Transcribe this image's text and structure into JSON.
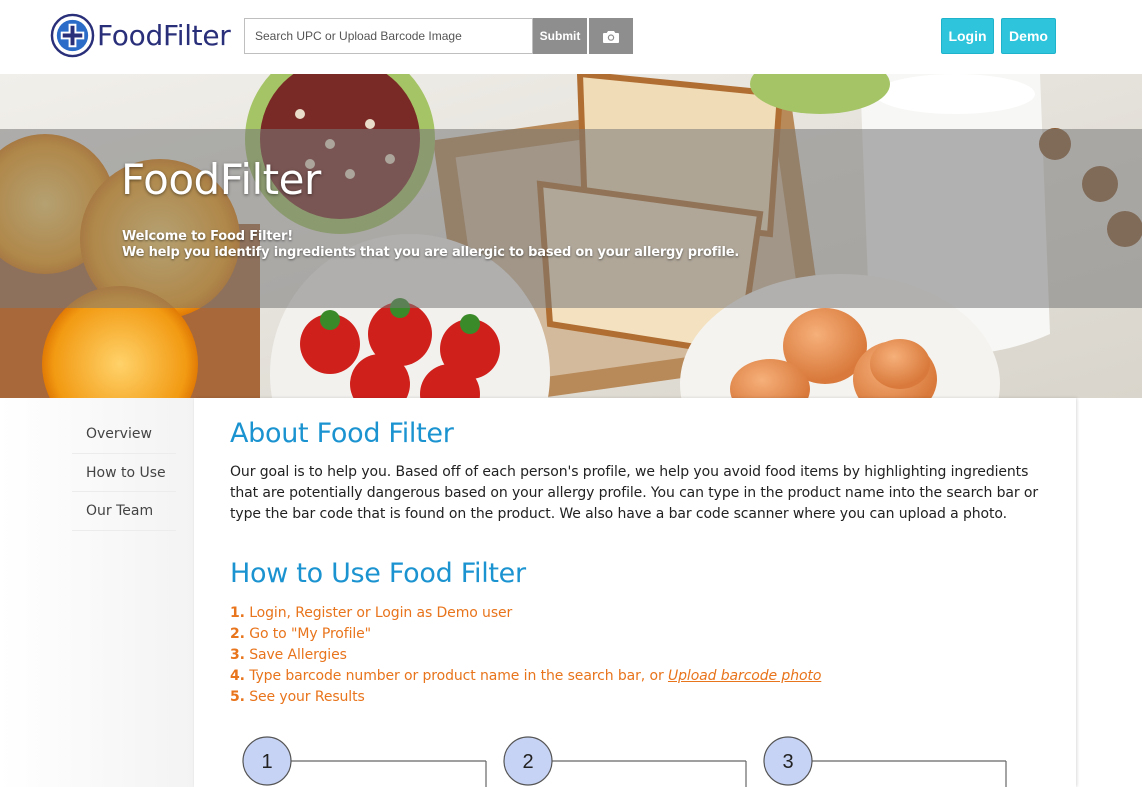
{
  "header": {
    "logo_text": "FoodFilter",
    "search_placeholder": "Search UPC or Upload Barcode Image",
    "submit_label": "Submit",
    "camera_icon": "camera-icon",
    "login_label": "Login",
    "demo_label": "Demo",
    "accent_color": "#2dc4dc"
  },
  "hero": {
    "title": "FoodFilter",
    "line1": "Welcome to Food Filter!",
    "line2": "We help you identify ingredients that you are allergic to based on your allergy profile."
  },
  "sidebar": {
    "items": [
      {
        "label": "Overview"
      },
      {
        "label": "How to Use"
      },
      {
        "label": "Our Team"
      }
    ]
  },
  "main": {
    "about_title": "About Food Filter",
    "about_text": "Our goal is to help you. Based off of each person's profile, we help you avoid food items by highlighting ingredients that are potentially dangerous based on your allergy profile. You can type in the product name into the search bar or type the bar code that is found on the product. We also have a bar code scanner where you can upload a photo.",
    "how_title": "How to Use Food Filter",
    "steps": [
      {
        "num": "1.",
        "text": " Login, Register or Login as Demo user"
      },
      {
        "num": "2.",
        "text": " Go to \"My Profile\""
      },
      {
        "num": "3.",
        "text": " Save Allergies"
      },
      {
        "num": "4.",
        "text": " Type barcode number or product name in the search bar, or ",
        "link": "Upload barcode photo"
      },
      {
        "num": "5.",
        "text": " See your Results"
      }
    ],
    "diagram_numbers": [
      "1",
      "2",
      "3"
    ],
    "heading_color": "#1b93d0",
    "step_color": "#e8741c"
  }
}
